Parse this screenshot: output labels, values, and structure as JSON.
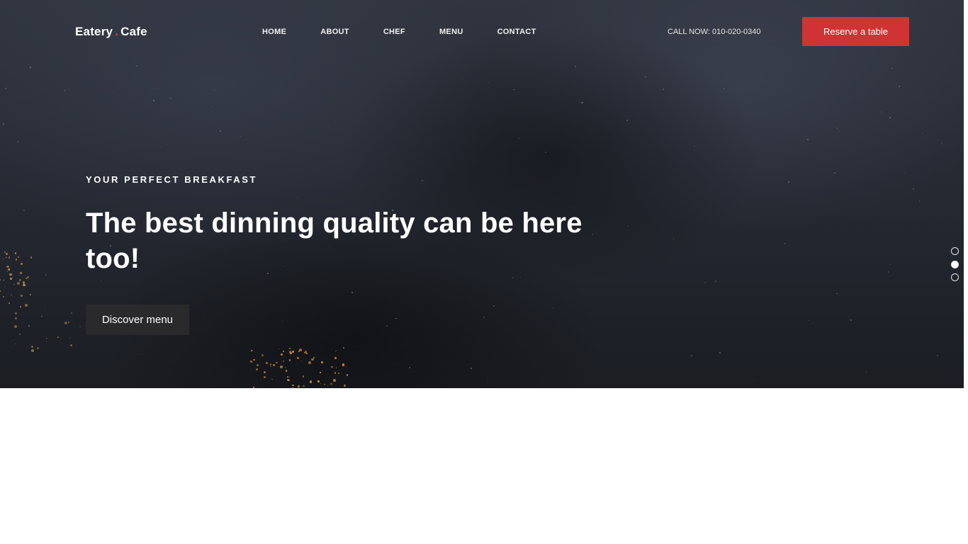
{
  "brand": {
    "part1": "Eatery",
    "separator": ".",
    "part2": "Cafe"
  },
  "nav": {
    "items": [
      {
        "label": "HOME"
      },
      {
        "label": "ABOUT"
      },
      {
        "label": "CHEF"
      },
      {
        "label": "MENU"
      },
      {
        "label": "CONTACT"
      }
    ],
    "call": "CALL NOW: 010-020-0340",
    "reserve_label": "Reserve a table"
  },
  "hero": {
    "eyebrow": "YOUR PERFECT BREAKFAST",
    "headline": "The best dinning quality can be here too!",
    "cta_label": "Discover menu"
  },
  "slider": {
    "slide_count": 3,
    "active_index": 1
  },
  "colors": {
    "accent": "#cf3333",
    "hero_bg": "#262a33",
    "cta_bg": "#2a2a2c",
    "page_bg": "#ffffff"
  }
}
